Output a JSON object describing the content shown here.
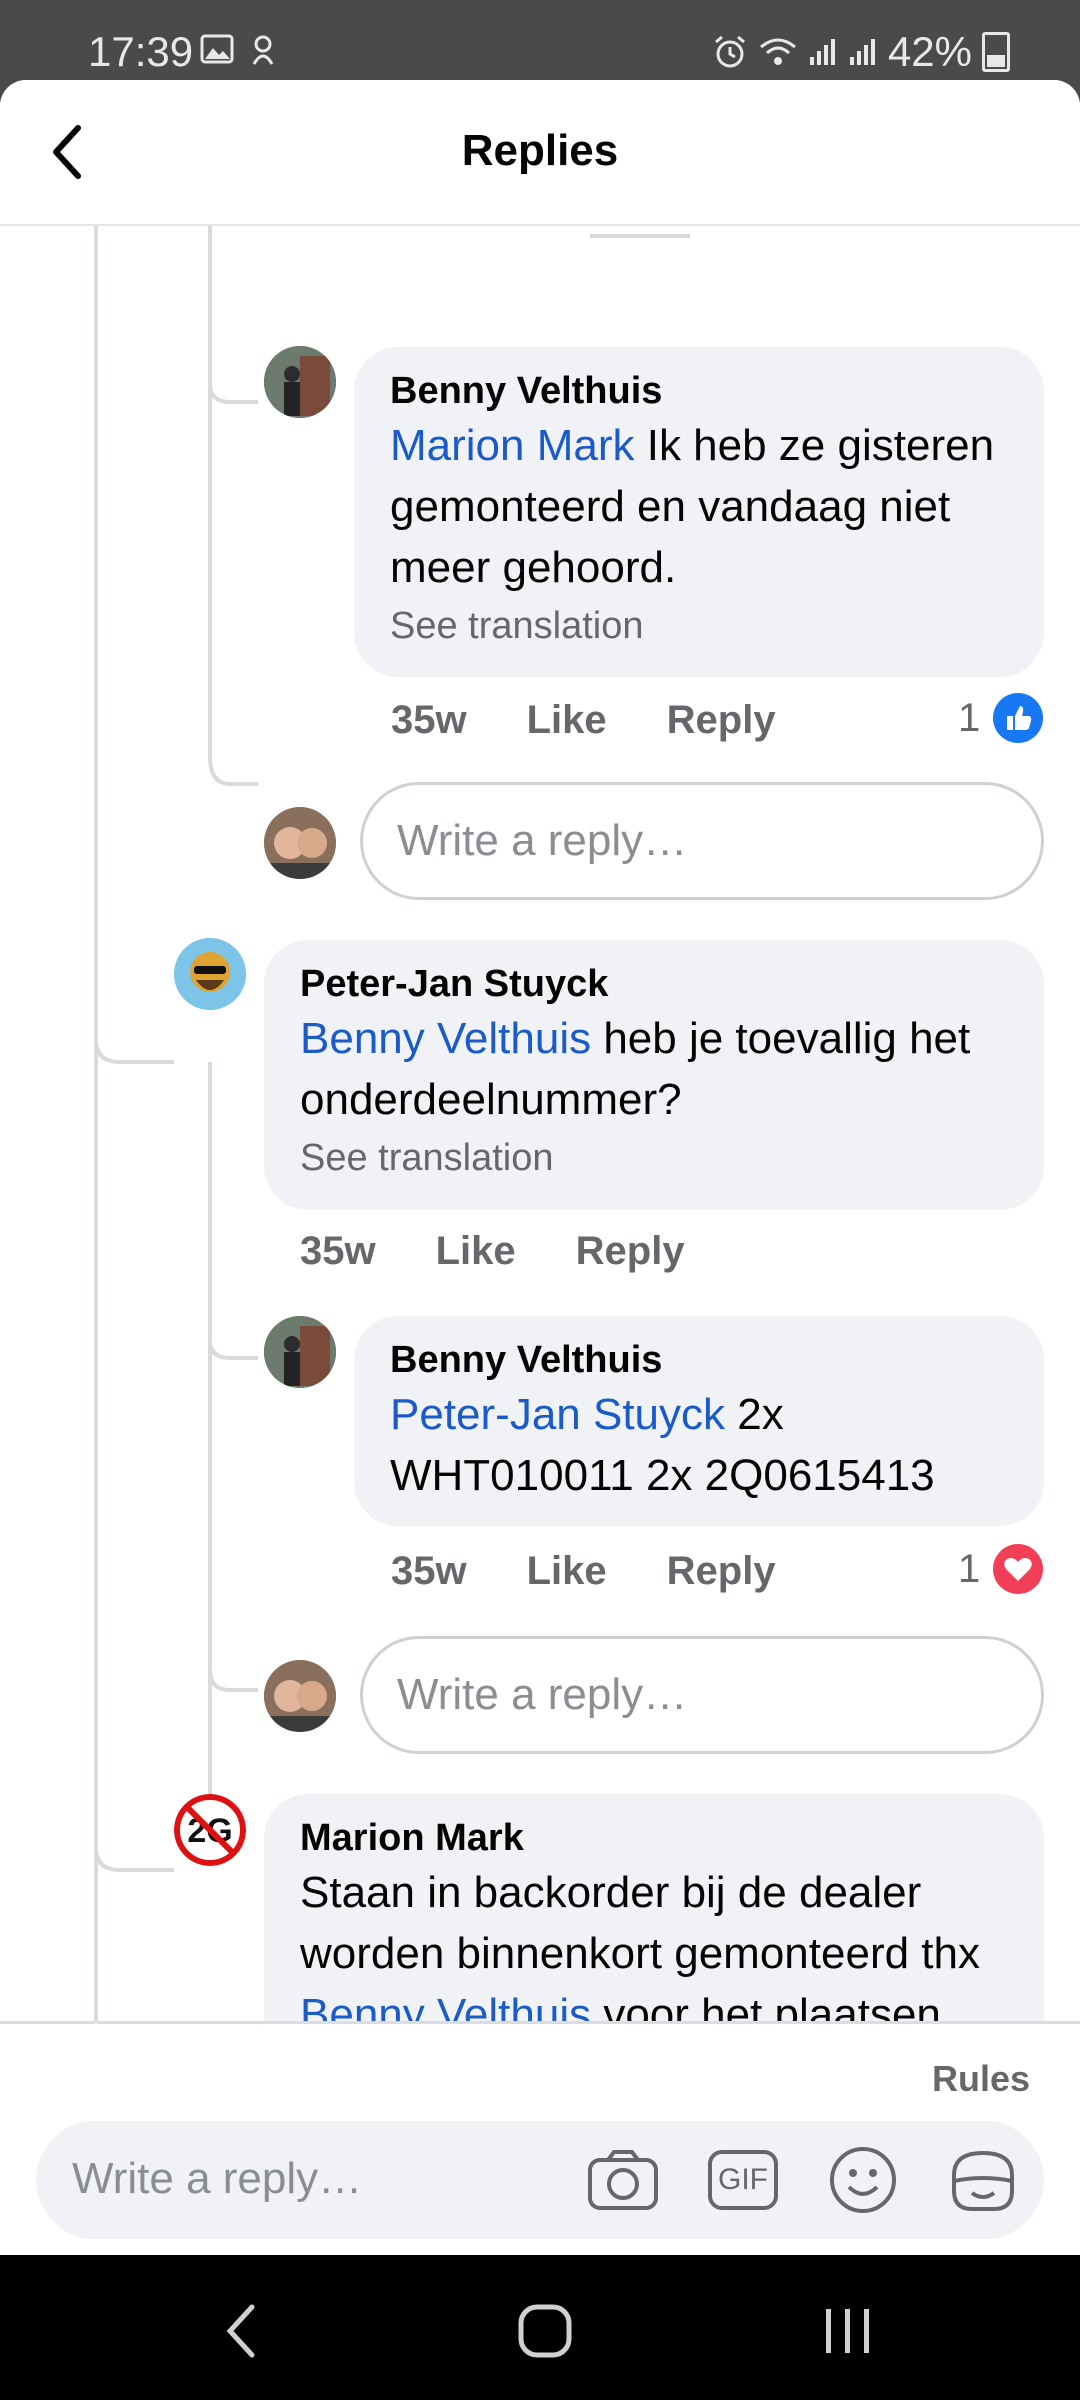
{
  "status_bar": {
    "time": "17:39",
    "battery": "42%"
  },
  "header": {
    "title": "Replies"
  },
  "comments": [
    {
      "author": "Benny Velthuis",
      "mention": "Marion Mark",
      "text": " Ik heb ze gisteren gemonteerd en vandaag niet meer gehoord.",
      "translation": "See translation",
      "time": "35w",
      "like": "Like",
      "reply": "Reply",
      "reaction_count": "1",
      "reaction_icon": "like-reaction-icon"
    },
    {
      "author": "Peter-Jan Stuyck",
      "mention": "Benny Velthuis",
      "text": " heb je toevallig het onderdeelnummer?",
      "translation": "See translation",
      "time": "35w",
      "like": "Like",
      "reply": "Reply"
    },
    {
      "author": "Benny Velthuis",
      "mention": "Peter-Jan Stuyck",
      "text": " 2x WHT010011 2x 2Q0615413",
      "time": "35w",
      "like": "Like",
      "reply": "Reply",
      "reaction_count": "1",
      "reaction_icon": "love-reaction-icon"
    },
    {
      "author": "Marion Mark",
      "text_before": "Staan in backorder bij de dealer worden binnenkort gemonteerd thx ",
      "mention": "Benny Velthuis",
      "text_after": " voor het plaatsen."
    }
  ],
  "inline_reply_placeholder": "Write a reply…",
  "footer": {
    "rules": "Rules",
    "composer_placeholder": "Write a reply…",
    "gif_label": "GIF"
  },
  "colors": {
    "mention": "#1b5bc9",
    "bubble": "#f0f2f5",
    "like_blue": "#1877f2",
    "love_red": "#f33e58"
  }
}
